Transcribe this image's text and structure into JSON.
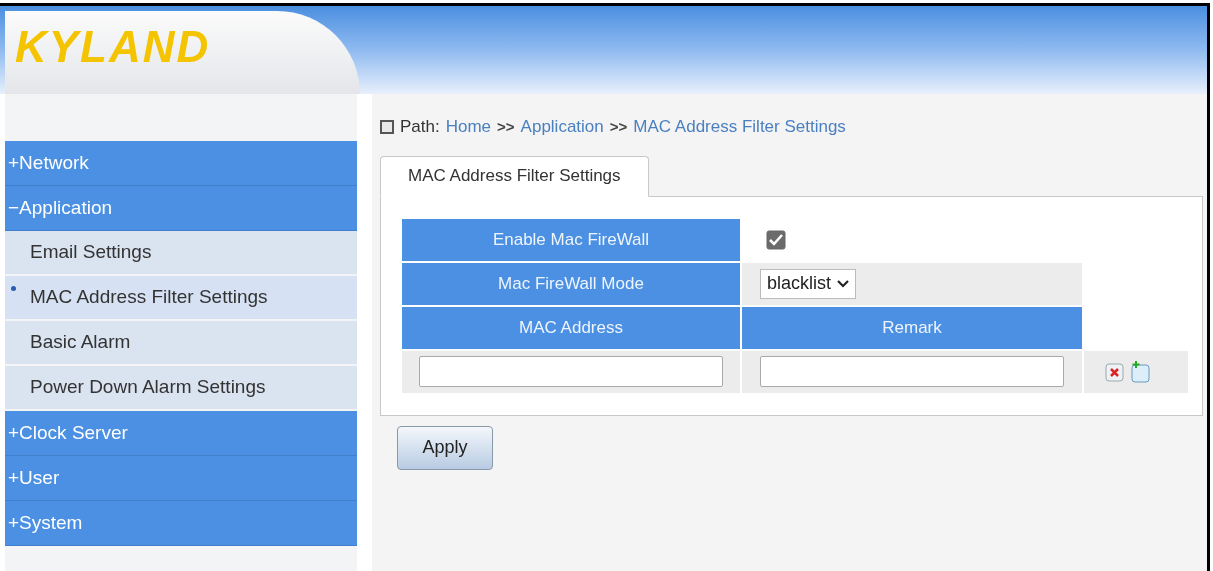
{
  "header": {
    "logo": "KYLAND"
  },
  "sidebar": {
    "groups": [
      {
        "label": "+Network"
      },
      {
        "label": "−Application",
        "children": [
          {
            "label": "Email Settings",
            "selected": false
          },
          {
            "label": "MAC Address Filter Settings",
            "selected": true
          },
          {
            "label": "Basic Alarm",
            "selected": false
          },
          {
            "label": "Power Down Alarm Settings",
            "selected": false
          }
        ]
      },
      {
        "label": "+Clock Server"
      },
      {
        "label": "+User"
      },
      {
        "label": "+System"
      }
    ]
  },
  "path": {
    "label": "Path:",
    "crumbs": [
      "Home",
      "Application",
      "MAC Address Filter Settings"
    ],
    "separator": ">>"
  },
  "tabs": [
    {
      "label": "MAC Address Filter Settings",
      "selected": true
    }
  ],
  "form": {
    "enable_label": "Enable Mac FireWall",
    "enable_checked": true,
    "mode_label": "Mac FireWall Mode",
    "mode_value": "blacklist"
  },
  "table": {
    "columns": [
      "MAC Address",
      "Remark"
    ]
  },
  "apply_button": "Apply"
}
